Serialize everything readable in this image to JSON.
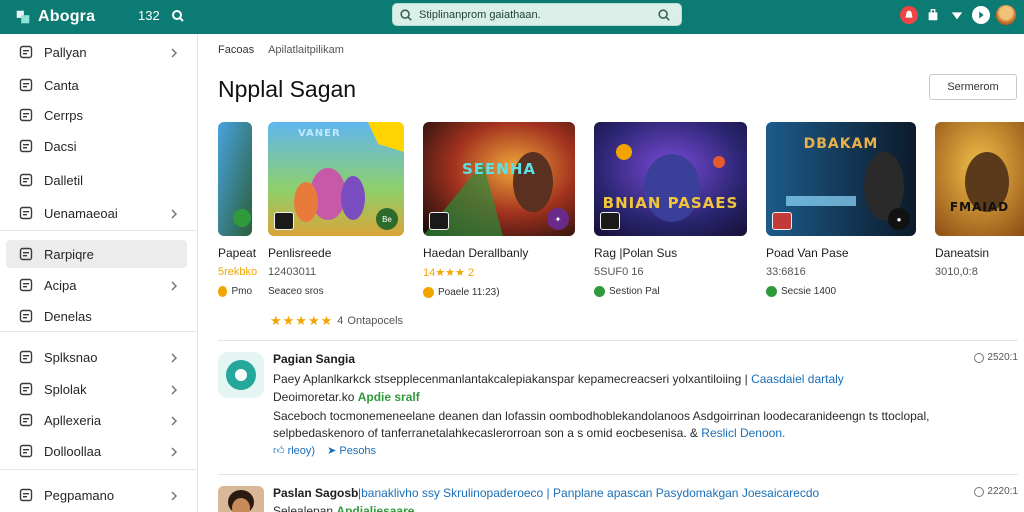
{
  "topbar": {
    "brand": "Abogra",
    "count": "132",
    "search_value": "Stiplinanprom gaiathaan.",
    "colors": {
      "bar": "#0b7b73",
      "accent": "#25a79b"
    }
  },
  "sidebar": {
    "items": [
      {
        "label": "Pallyan",
        "icon": "home-icon",
        "chevron": true
      },
      {
        "label": "Canta",
        "icon": "grid-icon",
        "chevron": false
      },
      {
        "label": "Cerrps",
        "icon": "edit-icon",
        "chevron": false
      },
      {
        "label": "Dacsi",
        "icon": "document-icon",
        "chevron": false
      },
      {
        "label": "Dalletil",
        "icon": "chart-icon",
        "chevron": false
      },
      {
        "label": "Uenamaeoai",
        "icon": "box-icon",
        "chevron": true
      },
      {
        "label": "Rarpiqre",
        "icon": "app-icon",
        "chevron": false,
        "active": true
      },
      {
        "label": "Acipa",
        "icon": "home-icon",
        "chevron": true
      },
      {
        "label": "Denelas",
        "icon": "doc-icon",
        "chevron": false
      },
      {
        "label": "Splksnao",
        "icon": "grid-icon",
        "chevron": true
      },
      {
        "label": "Splolak",
        "icon": "table-icon",
        "chevron": true
      },
      {
        "label": "Apllexeria",
        "icon": "star-icon",
        "chevron": true
      },
      {
        "label": "Dolloollaa",
        "icon": "layers-icon",
        "chevron": true
      },
      {
        "label": "Pegpamano",
        "icon": "folder-icon",
        "chevron": true
      }
    ]
  },
  "main": {
    "breadcrumb": [
      "Facoas",
      "Apilatlaitpilikam"
    ],
    "title": "Npplal Sagan",
    "sort_label": "Sermerom",
    "cards": [
      {
        "name": "Papeat",
        "meta": "5rekbko",
        "status": "Pmo",
        "art": ""
      },
      {
        "name": "Penlisreede",
        "meta": "12403011",
        "status": "Seaceo sros",
        "art": "VANER"
      },
      {
        "name": "Haedan Derallbanly",
        "meta": "14★★★ 2",
        "status": "Poaele 11:23)",
        "art": "SEENHA"
      },
      {
        "name": "Rag |Polan Sus",
        "meta": "5SUF0 16",
        "status": "Sestion Pal",
        "art": "BNIAN PASAES"
      },
      {
        "name": "Poad Van Pase",
        "meta": "33:6816",
        "status": "Secsie 1400",
        "art": "DBAKAM"
      },
      {
        "name": "Daneatsin",
        "meta": "3010,0:8",
        "status": "",
        "art": "FMAIAD"
      }
    ],
    "rating_row": {
      "stars": "★★★★★",
      "score": "4",
      "label": "Ontapocels"
    },
    "list": [
      {
        "title": "Pagian Sangia",
        "time": "2520:1",
        "line1": "Paey Aplanlkarkck stsepplecenmanlantakcalepiakanspar kepamecreacseri yolxantiloiing",
        "line1_link": "Caasdaiel dartaly",
        "line2": "Deoimoretar.ko",
        "line2_green": "Apdie sralf",
        "line3": "Saceboch tocmonemeneelane deanen dan lofassin oombodhoblekandolanoos Asdgoirrinan loodecaranideengn ts ttoclopal,",
        "line4": "selpbedaskenoro of tanferranetalahkecaslerorroan son a s omid eocbesenisa. &",
        "line4_link": "Reslicl Denoon.",
        "actions": [
          "rleoy)",
          "Pesohs"
        ]
      },
      {
        "title": "Paslan Sagosb",
        "time": "2220:1",
        "line1_link": "|banaklivho ssy Skrulinopaderoeco | Panplane apascan Pasydomakgan Joesaicarecdo",
        "line2": "Selealepan",
        "line2_green": "Apdialiesaare"
      }
    ]
  }
}
